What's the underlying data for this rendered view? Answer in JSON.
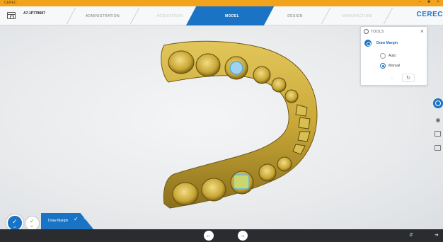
{
  "window": {
    "app_name": "CEREC",
    "controls": [
      "–",
      "■",
      "×"
    ]
  },
  "header": {
    "case_id": "A7-1P778687",
    "brand": "CEREC",
    "steps": [
      {
        "label": "ADMINISTRATION",
        "state": "done"
      },
      {
        "label": "ACQUISITION",
        "state": "inactive"
      },
      {
        "label": "MODEL",
        "state": "active"
      },
      {
        "label": "DESIGN",
        "state": "available"
      },
      {
        "label": "MANUFACTURE",
        "state": "inactive"
      }
    ]
  },
  "tools_panel": {
    "title": "TOOLS",
    "close": "×",
    "tool": "Draw Margin",
    "options": [
      {
        "label": "Auto",
        "selected": false
      },
      {
        "label": "Manual",
        "selected": true
      }
    ],
    "undo_icon": "undo-icon",
    "redo_icon": "redo-icon"
  },
  "side_toolbar": {
    "icons": [
      "margin-tool-icon",
      "eye-icon",
      "image-icon",
      "model-box-icon"
    ]
  },
  "workflow_widget": {
    "label": "Draw Margin",
    "step_main_number": "16",
    "step_second_number": "33"
  },
  "bottom_bar": {
    "prev_icon": "back-arrow-icon",
    "next_icon": "forward-arrow-icon"
  },
  "colors": {
    "accent": "#1a73c4",
    "top_strip": "#f2a21b",
    "model_gold": "#c9a838",
    "bottom_bar": "#2a2c2f"
  }
}
